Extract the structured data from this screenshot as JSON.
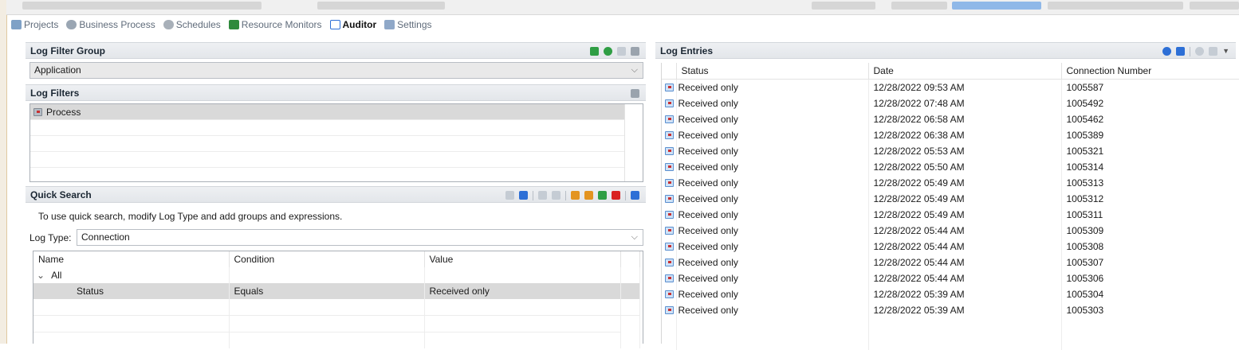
{
  "tabs": [
    {
      "label": "Projects",
      "icon": "projects-icon",
      "active": false
    },
    {
      "label": "Business Process",
      "icon": "business-process-icon",
      "active": false
    },
    {
      "label": "Schedules",
      "icon": "schedules-icon",
      "active": false
    },
    {
      "label": "Resource Monitors",
      "icon": "resource-monitors-icon",
      "active": false
    },
    {
      "label": "Auditor",
      "icon": "auditor-icon",
      "active": true
    },
    {
      "label": "Settings",
      "icon": "settings-icon",
      "active": false
    }
  ],
  "log_filter_group": {
    "title": "Log Filter Group",
    "selected": "Application"
  },
  "log_filters": {
    "title": "Log Filters",
    "items": [
      "Process"
    ]
  },
  "quick_search": {
    "title": "Quick Search",
    "hint": "To use quick search, modify Log Type and add groups and expressions.",
    "log_type_label": "Log Type:",
    "log_type_value": "Connection",
    "columns": [
      "Name",
      "Condition",
      "Value"
    ],
    "group_label": "All",
    "rows": [
      {
        "name": "Status",
        "condition": "Equals",
        "value": "Received only"
      }
    ]
  },
  "log_entries": {
    "title": "Log Entries",
    "columns": [
      "Status",
      "Date",
      "Connection Number"
    ],
    "rows": [
      {
        "status": "Received only",
        "date": "12/28/2022 09:53 AM",
        "number": "1005587"
      },
      {
        "status": "Received only",
        "date": "12/28/2022 07:48 AM",
        "number": "1005492"
      },
      {
        "status": "Received only",
        "date": "12/28/2022 06:58 AM",
        "number": "1005462"
      },
      {
        "status": "Received only",
        "date": "12/28/2022 06:38 AM",
        "number": "1005389"
      },
      {
        "status": "Received only",
        "date": "12/28/2022 05:53 AM",
        "number": "1005321"
      },
      {
        "status": "Received only",
        "date": "12/28/2022 05:50 AM",
        "number": "1005314"
      },
      {
        "status": "Received only",
        "date": "12/28/2022 05:49 AM",
        "number": "1005313"
      },
      {
        "status": "Received only",
        "date": "12/28/2022 05:49 AM",
        "number": "1005312"
      },
      {
        "status": "Received only",
        "date": "12/28/2022 05:49 AM",
        "number": "1005311"
      },
      {
        "status": "Received only",
        "date": "12/28/2022 05:44 AM",
        "number": "1005309"
      },
      {
        "status": "Received only",
        "date": "12/28/2022 05:44 AM",
        "number": "1005308"
      },
      {
        "status": "Received only",
        "date": "12/28/2022 05:44 AM",
        "number": "1005307"
      },
      {
        "status": "Received only",
        "date": "12/28/2022 05:44 AM",
        "number": "1005306"
      },
      {
        "status": "Received only",
        "date": "12/28/2022 05:39 AM",
        "number": "1005304"
      },
      {
        "status": "Received only",
        "date": "12/28/2022 05:39 AM",
        "number": "1005303"
      }
    ]
  },
  "colors": {
    "header_bg": "#e3e6ea",
    "selected_row": "#d9d9d9",
    "active_tab_icon": "#2d6fd6"
  }
}
